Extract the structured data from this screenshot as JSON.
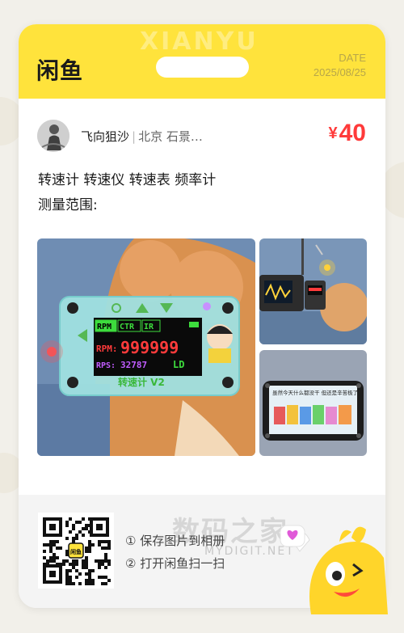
{
  "header": {
    "logo_text": "闲鱼",
    "date_label": "DATE",
    "date_value": "2025/08/25"
  },
  "seller": {
    "name": "飞向狙沙",
    "location": "北京 石景…"
  },
  "price": {
    "currency": "¥",
    "amount": "40"
  },
  "description": {
    "line1": "转速计 转速仪 转速表 频率计",
    "line2": "测量范围:"
  },
  "photos": {
    "main": {
      "modes": [
        "RPM",
        "CTR",
        "IR"
      ],
      "rpm_label": "RPM:",
      "rpm_value": "999999",
      "rps_label": "RPS:",
      "rps_value": "32787",
      "ld_label": "LD",
      "device_label": "转速计 V2"
    },
    "bottom": {
      "caption": "虽然今天什么都没干 但还是辛苦极了!"
    }
  },
  "footer": {
    "step1": "① 保存图片到相册",
    "step2": "② 打开闲鱼扫一扫",
    "watermark": "数码之家",
    "watermark_sub": "MYDIGIT.NET",
    "qr_logo": "闲鱼"
  },
  "colors": {
    "brand_yellow": "#ffe33c",
    "price_red": "#ff3a3a"
  }
}
